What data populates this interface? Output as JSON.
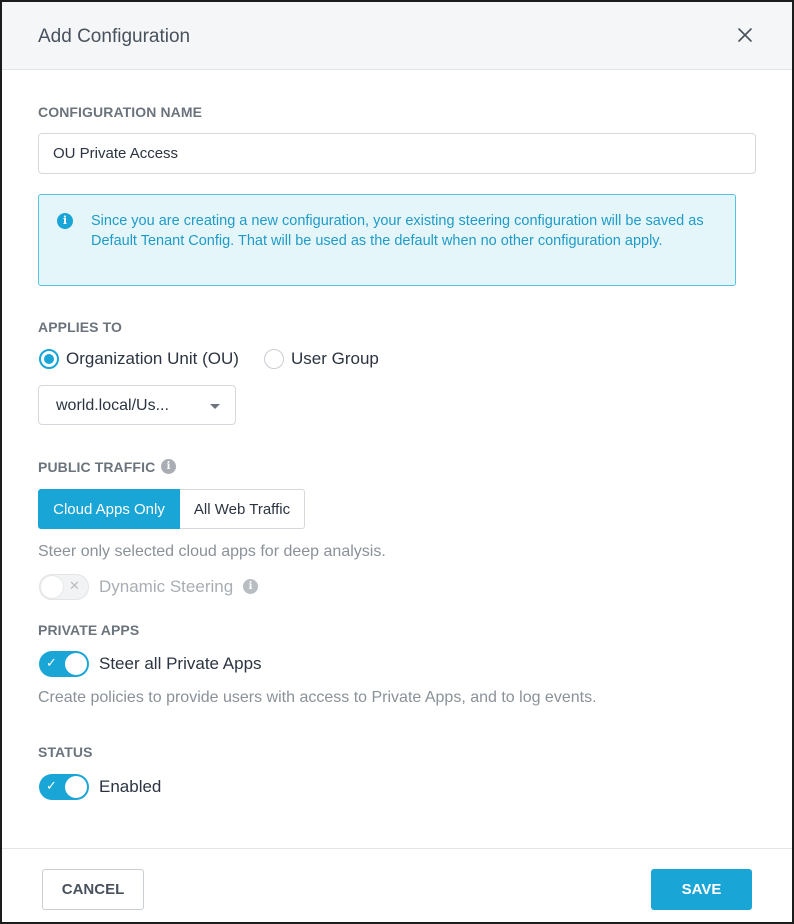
{
  "dialog": {
    "title": "Add Configuration",
    "close_icon": "close-icon"
  },
  "config_name": {
    "label": "CONFIGURATION NAME",
    "value": "OU Private Access"
  },
  "info": {
    "icon": "info-icon",
    "icon_glyph": "i",
    "text": "Since you are creating a new configuration, your existing steering configuration will be saved as Default Tenant Config. That will be used as the default when no other configuration apply."
  },
  "applies_to": {
    "label": "APPLIES TO",
    "options": [
      {
        "label": "Organization Unit (OU)",
        "checked": true
      },
      {
        "label": "User Group",
        "checked": false
      }
    ],
    "select_value": "world.local/Us..."
  },
  "public_traffic": {
    "label": "PUBLIC TRAFFIC",
    "help_glyph": "i",
    "segments": [
      {
        "label": "Cloud Apps Only",
        "active": true
      },
      {
        "label": "All Web Traffic",
        "active": false
      }
    ],
    "helper": "Steer only selected cloud apps for deep analysis.",
    "dynamic_steering": {
      "label": "Dynamic Steering",
      "enabled": false,
      "mark": "✕"
    }
  },
  "private_apps": {
    "label": "PRIVATE APPS",
    "toggle_label": "Steer all Private Apps",
    "enabled": true,
    "mark": "✓",
    "helper": "Create policies to provide users with access to Private Apps, and to log events."
  },
  "status": {
    "label": "STATUS",
    "toggle_label": "Enabled",
    "enabled": true,
    "mark": "✓"
  },
  "footer": {
    "cancel_label": "CANCEL",
    "save_label": "SAVE"
  },
  "colors": {
    "accent": "#1aa5d7",
    "info_bg": "#e5f6fa",
    "info_border": "#57c3e0"
  }
}
